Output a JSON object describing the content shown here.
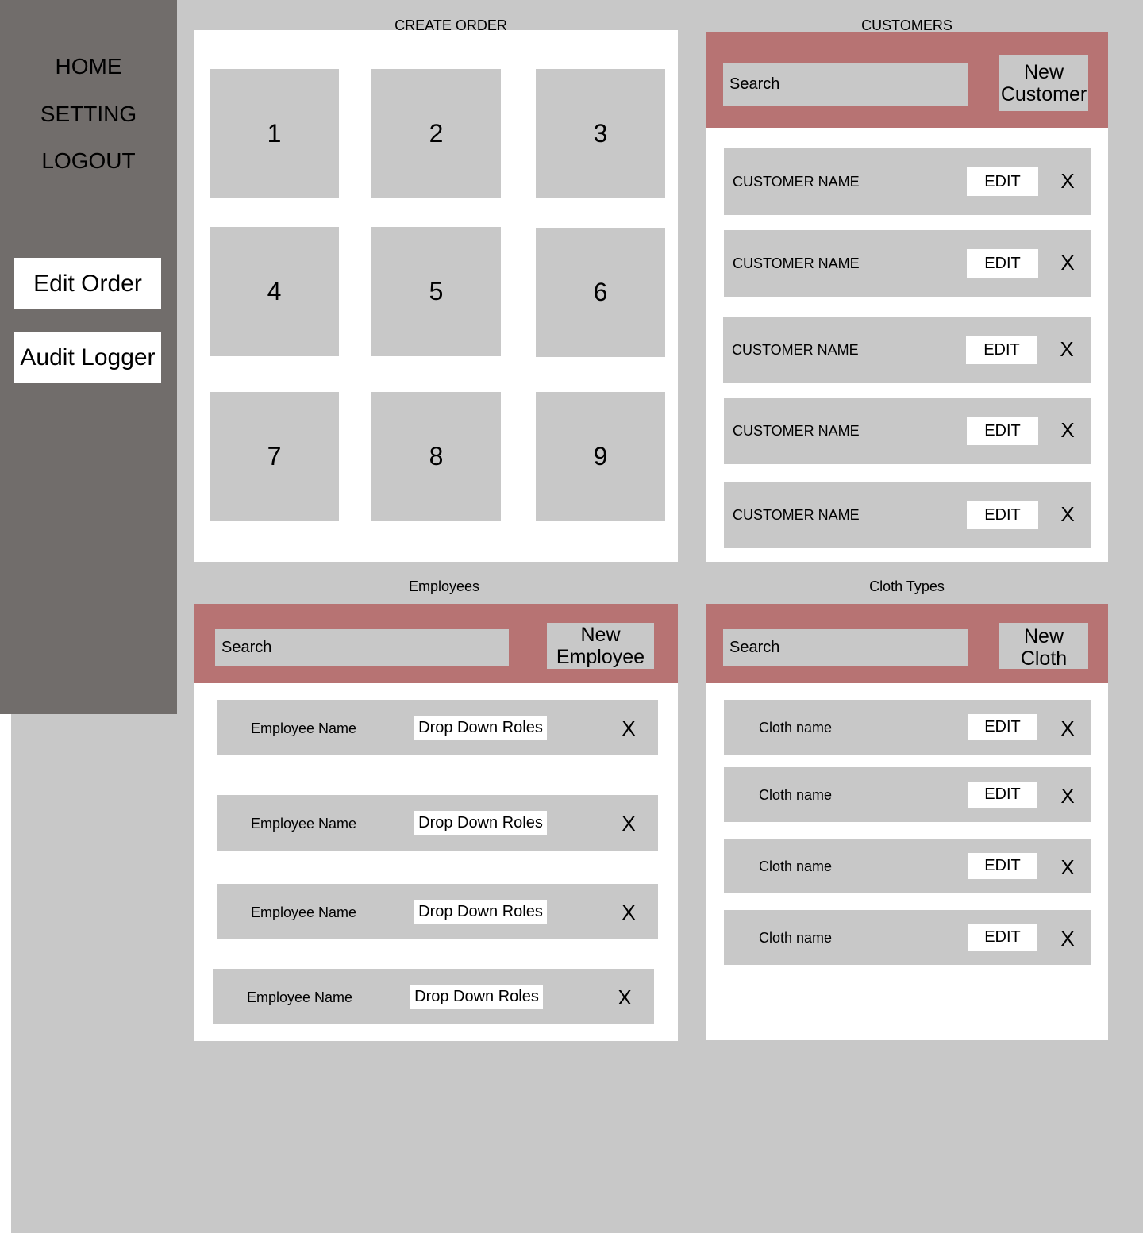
{
  "sidebar": {
    "nav": [
      "HOME",
      "SETTING",
      "LOGOUT"
    ],
    "buttons": [
      "Edit Order",
      "Audit Logger"
    ]
  },
  "create_order": {
    "title": "CREATE ORDER",
    "tiles": [
      "1",
      "2",
      "3",
      "4",
      "5",
      "6",
      "7",
      "8",
      "9"
    ]
  },
  "customers": {
    "title": "CUSTOMERS",
    "search_placeholder": "Search",
    "new_button": "New\nCustomer",
    "rows": [
      {
        "name": "CUSTOMER NAME",
        "edit": "EDIT",
        "remove": "X"
      },
      {
        "name": "CUSTOMER NAME",
        "edit": "EDIT",
        "remove": "X"
      },
      {
        "name": "CUSTOMER NAME",
        "edit": "EDIT",
        "remove": "X"
      },
      {
        "name": "CUSTOMER NAME",
        "edit": "EDIT",
        "remove": "X"
      },
      {
        "name": "CUSTOMER NAME",
        "edit": "EDIT",
        "remove": "X"
      }
    ]
  },
  "employees": {
    "title": "Employees",
    "search_placeholder": "Search",
    "new_button": "New\nEmployee",
    "rows": [
      {
        "name": "Employee Name",
        "role": "Drop Down Roles",
        "remove": "X"
      },
      {
        "name": "Employee Name",
        "role": "Drop Down Roles",
        "remove": "X"
      },
      {
        "name": "Employee Name",
        "role": "Drop Down Roles",
        "remove": "X"
      },
      {
        "name": "Employee Name",
        "role": "Drop Down Roles",
        "remove": "X"
      }
    ]
  },
  "cloth_types": {
    "title": "Cloth Types",
    "search_placeholder": "Search",
    "new_button": "New\nCloth",
    "rows": [
      {
        "name": "Cloth name",
        "edit": "EDIT",
        "remove": "X"
      },
      {
        "name": "Cloth name",
        "edit": "EDIT",
        "remove": "X"
      },
      {
        "name": "Cloth name",
        "edit": "EDIT",
        "remove": "X"
      },
      {
        "name": "Cloth name",
        "edit": "EDIT",
        "remove": "X"
      }
    ]
  },
  "colors": {
    "page_bg": "#c8c8c8",
    "sidebar": "#716d6b",
    "panel": "#ffffff",
    "header_bar": "#b77373",
    "item": "#c8c8c8"
  }
}
